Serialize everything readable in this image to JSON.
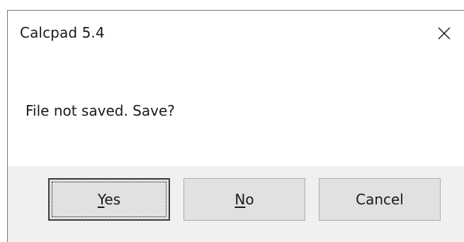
{
  "dialog": {
    "title": "Calcpad 5.4",
    "message": "File not saved. Save?",
    "close_icon": "close-icon"
  },
  "buttons": {
    "yes": {
      "mnemonic": "Y",
      "rest": "es"
    },
    "no": {
      "mnemonic": "N",
      "rest": "o"
    },
    "cancel": {
      "label": "Cancel"
    }
  },
  "colors": {
    "footer_bg": "#f0f0f0",
    "button_bg": "#e1e1e1",
    "button_border": "#adadad",
    "text": "#1a1a1a"
  }
}
